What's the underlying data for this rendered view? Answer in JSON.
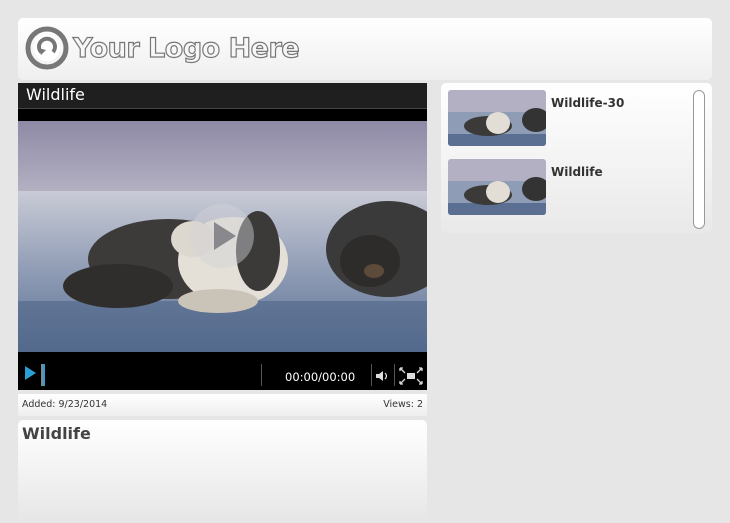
{
  "header": {
    "logo_text": "Your Logo Here",
    "logo_icon": "circular-arrow-logo-icon"
  },
  "player": {
    "title": "Wildlife",
    "time": "00:00/00:00",
    "accent_color": "#2a9fd6",
    "icons": [
      "play-icon",
      "volume-icon",
      "fullscreen-icon",
      "play-overlay-icon"
    ]
  },
  "meta": {
    "added": "Added: 9/23/2014",
    "views": "Views: 2"
  },
  "description": {
    "title": "Wildlife"
  },
  "playlist": {
    "items": [
      {
        "label": "Wildlife-30"
      },
      {
        "label": "Wildlife"
      }
    ]
  }
}
